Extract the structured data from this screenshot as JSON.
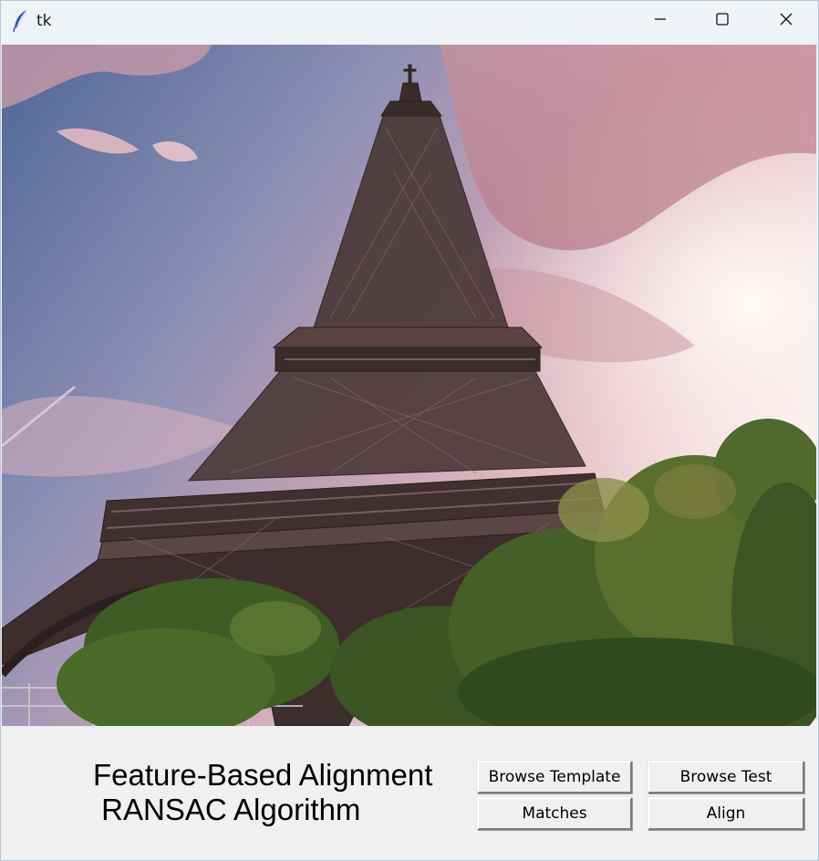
{
  "window": {
    "title": "tk",
    "controls": {
      "minimize": "minimize",
      "maximize": "maximize",
      "close": "close"
    }
  },
  "main": {
    "image_alt": "Eiffel Tower photograph",
    "heading": "Feature-Based Alignment\n RANSAC Algorithm"
  },
  "buttons": {
    "browse_template": "Browse Template",
    "browse_test": "Browse Test",
    "matches": "Matches",
    "align": "Align"
  },
  "colors": {
    "titlebar_bg": "#eef3f8",
    "window_bg": "#f0f0f0",
    "sky_blue": "#6a7ea8",
    "sky_pink": "#d9a9b4",
    "tower": "#3d2e2e",
    "trees": "#3e5a25"
  }
}
